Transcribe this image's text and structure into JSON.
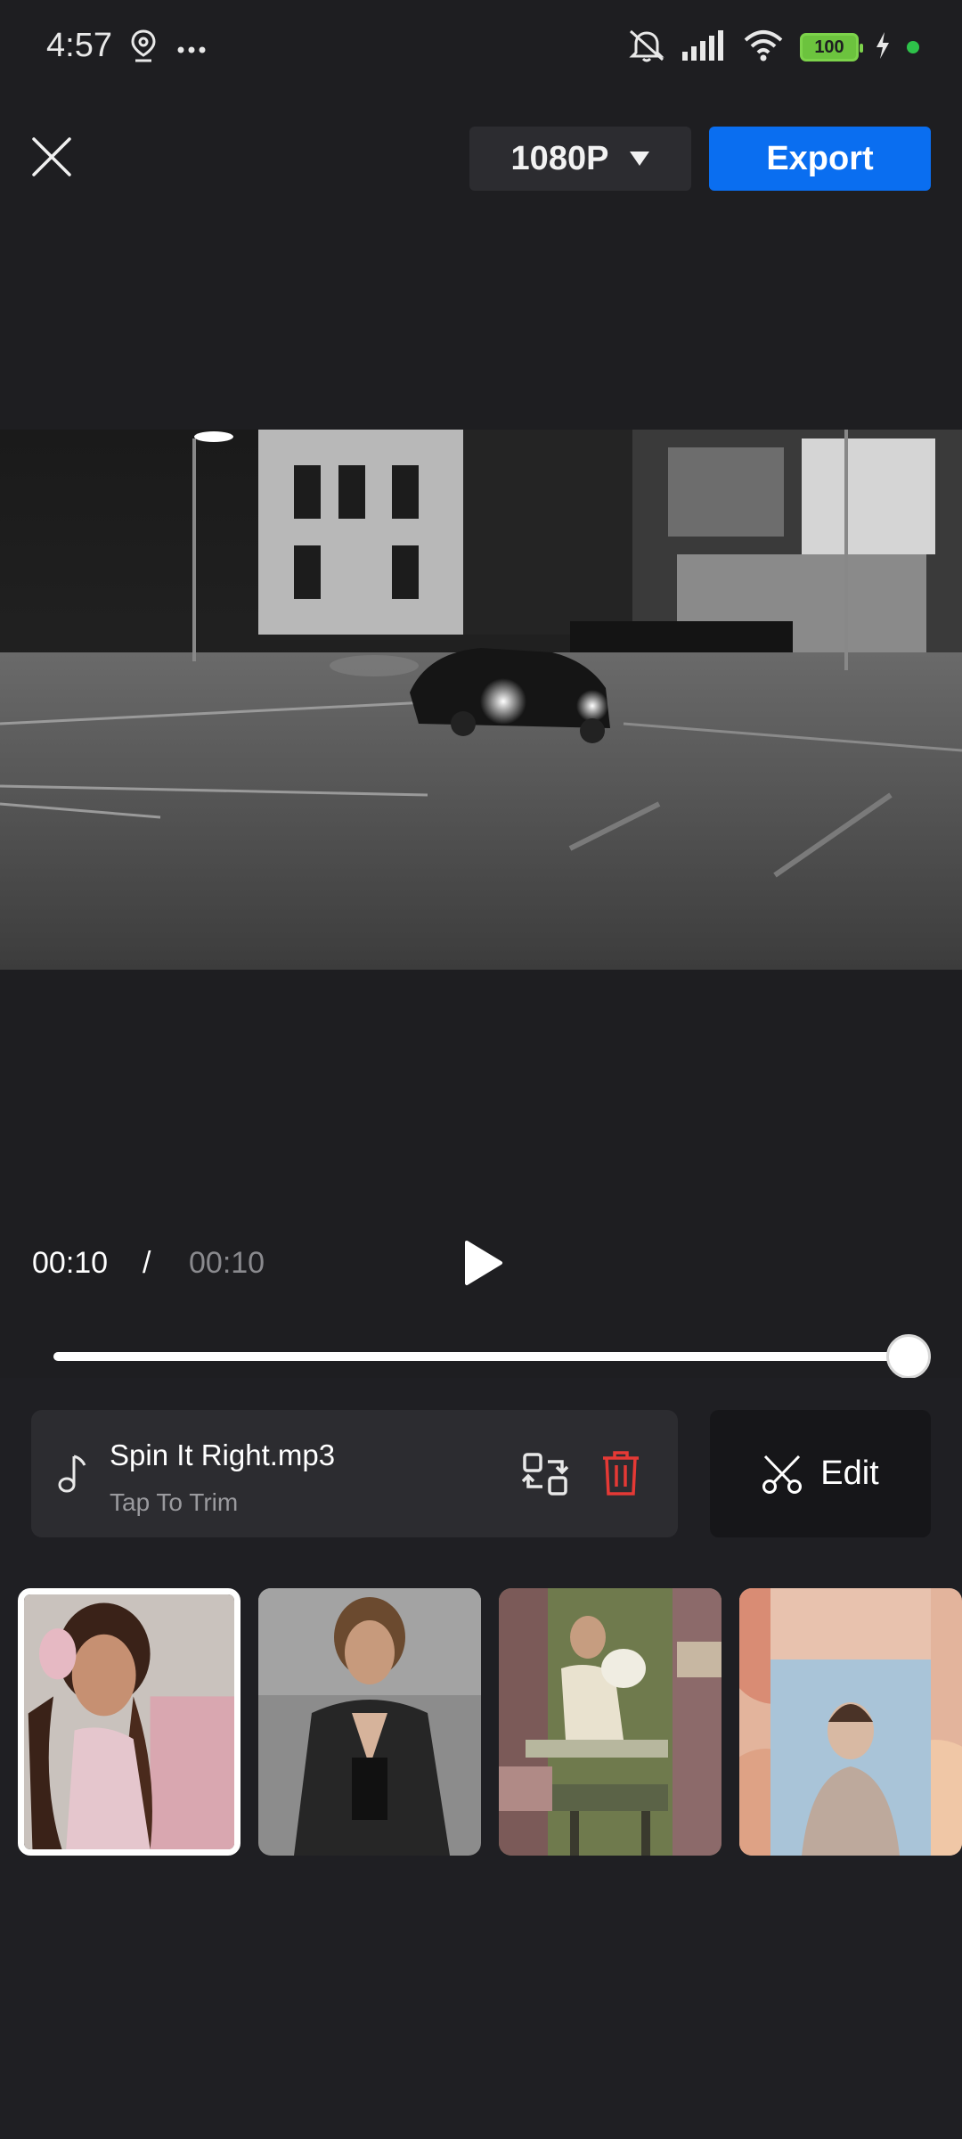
{
  "status_bar": {
    "time": "4:57",
    "left_icons": [
      "location-pin-icon",
      "more-dots-icon"
    ],
    "right_icons": [
      "mute-icon",
      "signal-icon",
      "wifi-icon",
      "battery-icon",
      "charging-icon"
    ],
    "battery_level": "100"
  },
  "toolbar": {
    "close_icon": "close-icon",
    "resolution_label": "1080P",
    "export_label": "Export",
    "export_color": "#0a6ef0"
  },
  "preview": {
    "scene": "night parking lot with drifting car, black and white"
  },
  "playback": {
    "current_time": "00:10",
    "separator": "/",
    "total_time": "00:10",
    "progress_fraction": 1.0
  },
  "music": {
    "title": "Spin It Right.mp3",
    "subtitle": "Tap To Trim",
    "delete_color": "#e53935"
  },
  "edit": {
    "label": "Edit"
  },
  "thumbnails": [
    {
      "name": "thumbnail-1",
      "selected": true
    },
    {
      "name": "thumbnail-2",
      "selected": false
    },
    {
      "name": "thumbnail-3",
      "selected": false
    },
    {
      "name": "thumbnail-4",
      "selected": false
    }
  ]
}
